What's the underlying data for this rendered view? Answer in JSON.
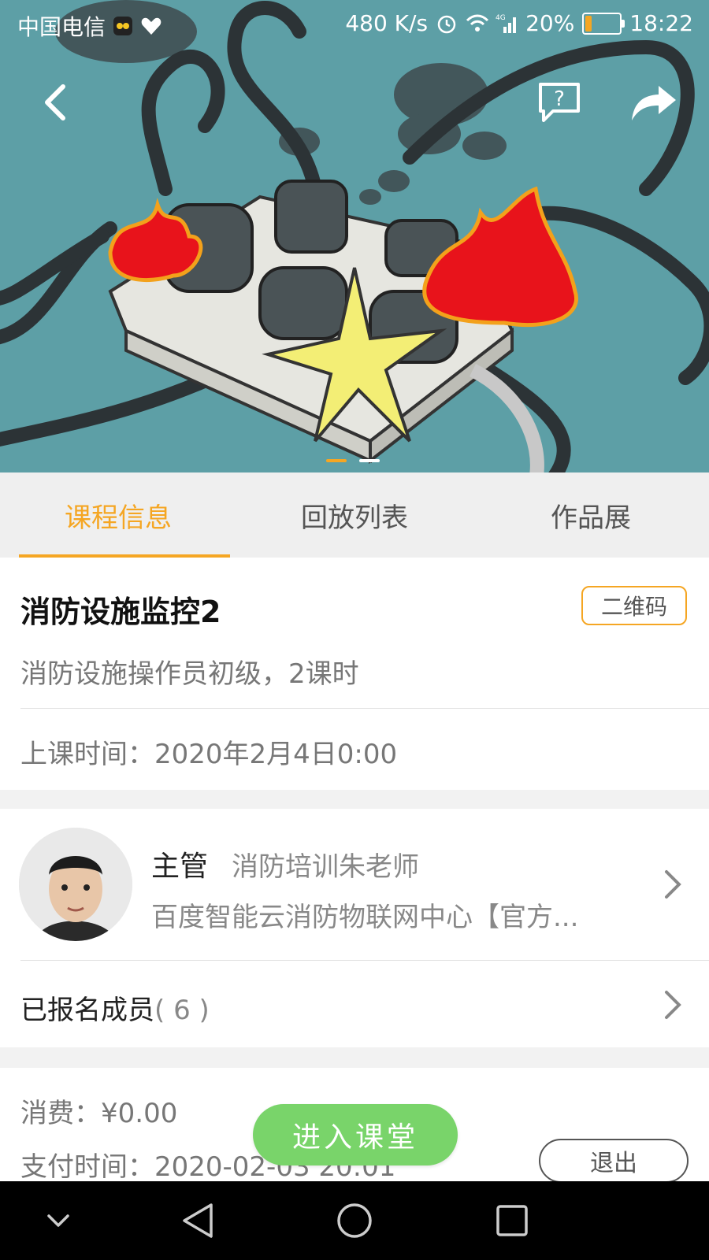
{
  "status_bar": {
    "carrier": "中国电信",
    "speed": "480 K/s",
    "network": "4G",
    "battery": "20%",
    "battery_level": 0.2,
    "time": "18:22"
  },
  "hero": {
    "icons": [
      "back-icon",
      "help-icon",
      "share-icon"
    ],
    "carousel_pages": 2,
    "active_page": 1
  },
  "tabs": [
    {
      "label": "课程信息",
      "active": true
    },
    {
      "label": "回放列表",
      "active": false
    },
    {
      "label": "作品展",
      "active": false
    }
  ],
  "course": {
    "title": "消防设施监控2",
    "qr_label": "二维码",
    "subtitle": "消防设施操作员初级，2课时",
    "time_label": "上课时间：",
    "time_value": "2020年2月4日0:00"
  },
  "teacher": {
    "role": "主管",
    "name": "消防培训朱老师",
    "org": "百度智能云消防物联网中心【官方..."
  },
  "members": {
    "label": "已报名成员",
    "count": "( 6 )"
  },
  "payment": {
    "fee_label": "消费：",
    "fee_value": "¥0.00",
    "paytime_label": "支付时间：",
    "paytime_value": "2020-02-03 20:01"
  },
  "actions": {
    "enter": "进入课堂",
    "exit": "退出"
  },
  "colors": {
    "accent": "#f5a623",
    "enter_green": "#79d46a",
    "banner_bg": "#5a9ba3"
  }
}
